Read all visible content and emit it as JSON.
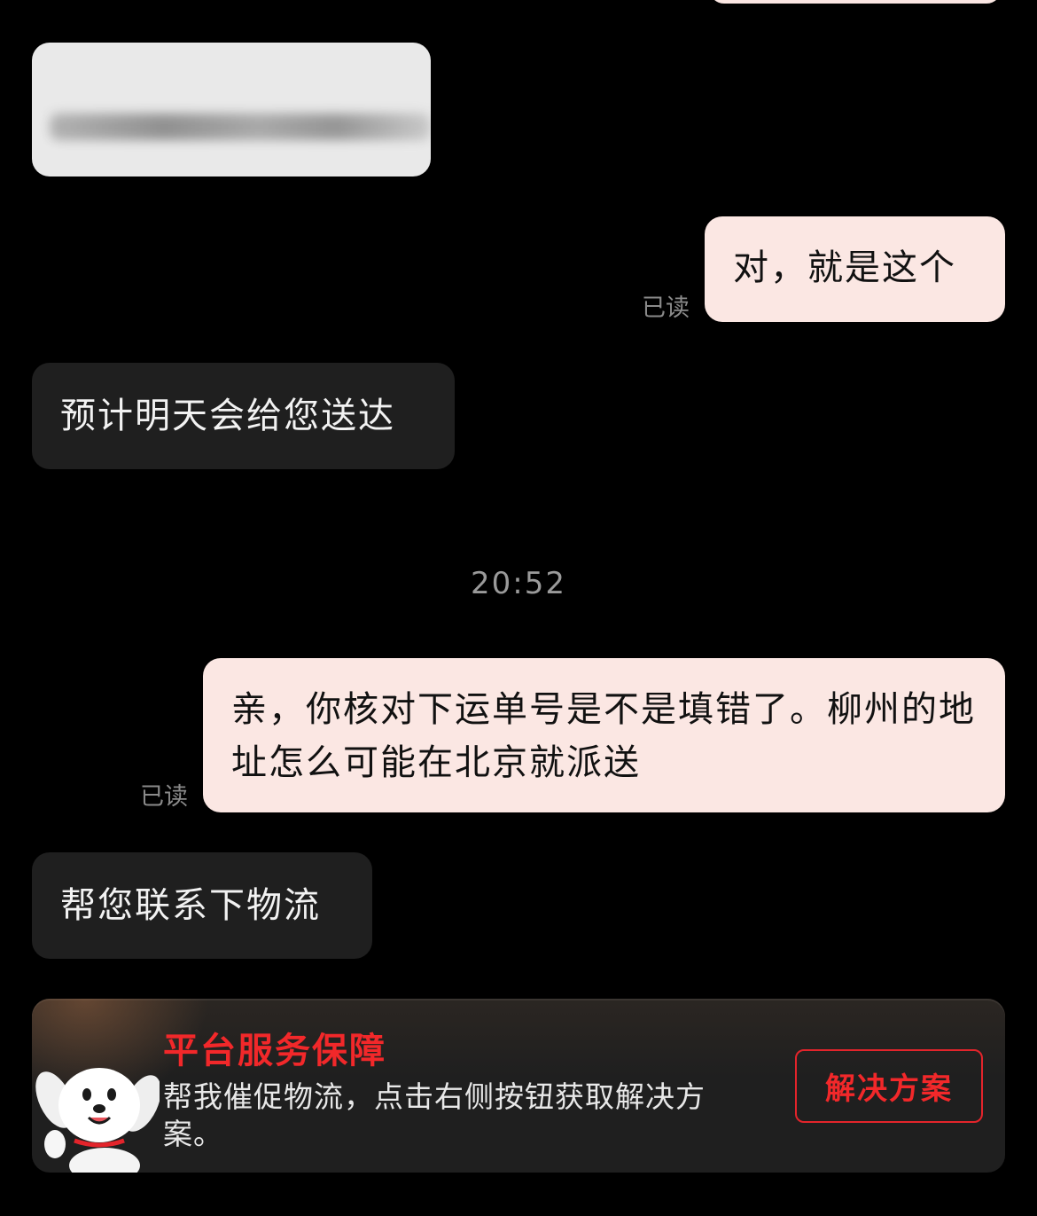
{
  "messages": {
    "msg_confirm": "对，就是这个",
    "msg_eta": "预计明天会给您送达",
    "msg_question": "亲，你核对下运单号是不是填错了。柳州的地址怎么可能在北京就派送",
    "msg_contact": "帮您联系下物流",
    "read_label_1": "已读",
    "read_label_2": "已读"
  },
  "timestamp": "20:52",
  "service_card": {
    "title": "平台服务保障",
    "description": "帮我催促物流，点击右侧按钮获取解决方案。",
    "button_label": "解决方案",
    "mascot_icon": "jd-dog-mascot-icon"
  },
  "colors": {
    "background": "#000000",
    "incoming_bubble": "#1f1f1f",
    "outgoing_bubble": "#fbe7e3",
    "accent_red": "#f2282a"
  }
}
